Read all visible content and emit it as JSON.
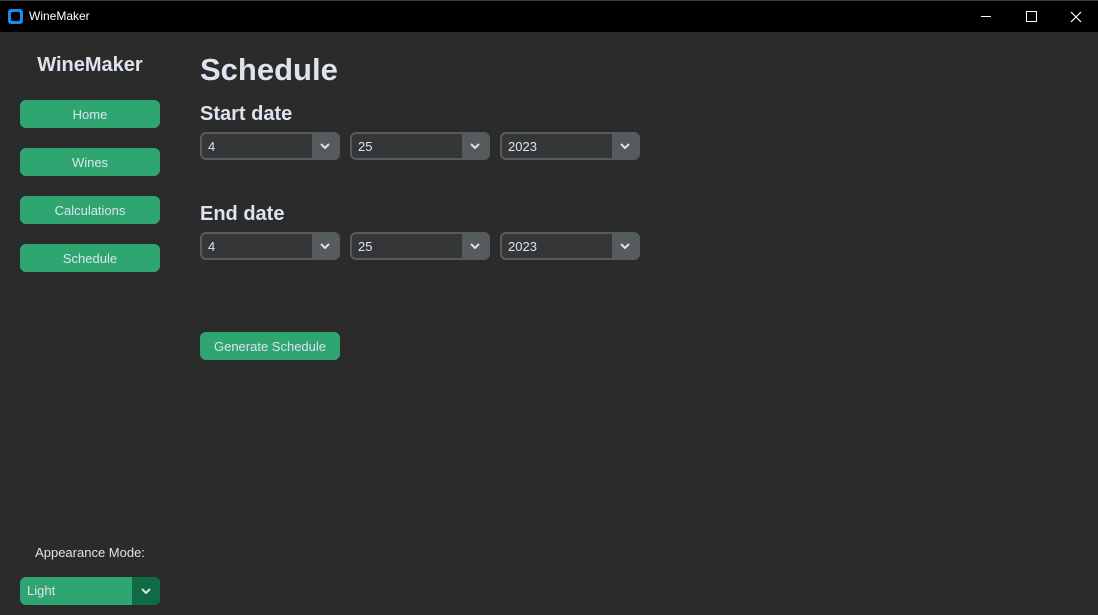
{
  "window": {
    "title": "WineMaker",
    "icon": "app-icon",
    "controls": [
      "minimize-icon",
      "maximize-icon",
      "close-icon"
    ]
  },
  "sidebar": {
    "logo": "WineMaker",
    "items": [
      {
        "label": "Home"
      },
      {
        "label": "Wines"
      },
      {
        "label": "Calculations"
      },
      {
        "label": "Schedule"
      }
    ],
    "appearance_label": "Appearance Mode:",
    "appearance_value": "Light"
  },
  "main": {
    "title": "Schedule",
    "start_date": {
      "label": "Start date",
      "month": "4",
      "day": "25",
      "year": "2023"
    },
    "end_date": {
      "label": "End date",
      "month": "4",
      "day": "25",
      "year": "2023"
    },
    "generate_label": "Generate Schedule"
  },
  "colors": {
    "background": "#2b2b2b",
    "titlebar": "#000000",
    "accent": "#2fa572",
    "accent_dark": "#106a43",
    "combo_bg": "#343638",
    "combo_border": "#565b5e",
    "text": "#dce4ee"
  }
}
